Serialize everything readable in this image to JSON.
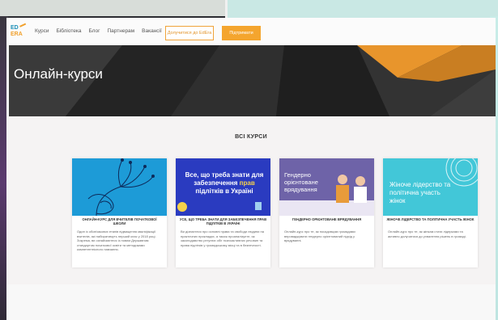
{
  "header": {
    "logo_top": "ED",
    "logo_bottom": "ERA",
    "nav": [
      "Курси",
      "Бібліотека",
      "Блог",
      "Партнерам",
      "Вакансії"
    ],
    "join_button": "Долучитися до EdEra",
    "support_button": "Підтримати"
  },
  "hero": {
    "title": "Онлайн-курси"
  },
  "courses": {
    "section_title": "ВСІ КУРСИ",
    "cards": [
      {
        "title": "ОНЛАЙН-КУРС ДЛЯ ВЧИТЕЛІВ ПОЧАТКОВОЇ ШКОЛИ",
        "desc": "Один із обов'язкових етапів підвищення кваліфікації вчителів, які набиратимуть перший клас у 2018 році. Зокрема, ви ознайомитеся із новим Державним стандартом початкової освіти та методиками компетентнісного навчання.",
        "image_text": ""
      },
      {
        "title": "УСЕ, ЩО ТРЕБА ЗНАТИ ДЛЯ ЗАБЕЗПЕЧЕННЯ ПРАВ ПІДЛІТКІВ В УКРАЇНІ",
        "desc": "Ви дізнаєтеся про основні права та свободи людини на практичних прикладах, а також проаналізуєте, як законодавство регулює обіг психоактивних речовин та права підлітків у громадському місці та в безпечності.",
        "image_text_1": "Все, що треба знати для забезпечення ",
        "image_text_hl": "прав",
        "image_text_2": " підлітків в Україні"
      },
      {
        "title": "ГЕНДЕРНО ОРІЄНТОВАНЕ ВРЯДУВАННЯ",
        "desc": "Онлайн-курс про те, як посадовцям громадами впроваджувати гендерно орієнтований підхід у врядуванні.",
        "image_text": "Гендерно орієнтоване врядування"
      },
      {
        "title": "ЖІНОЧЕ ЛІДЕРСТВО ТА ПОЛІТИЧНА УЧАСТЬ ЖІНОК",
        "desc": "Онлайн-курс про те, як жінкам стати лідерками та активно долучатися до ухвалення рішень в громаді.",
        "image_text": "Жіноче лідерство та політична участь жінок"
      }
    ]
  },
  "colors": {
    "accent_orange": "#f4a52e",
    "brand_blue": "#1c8fb7",
    "hero_dark": "#2a2a2a"
  }
}
